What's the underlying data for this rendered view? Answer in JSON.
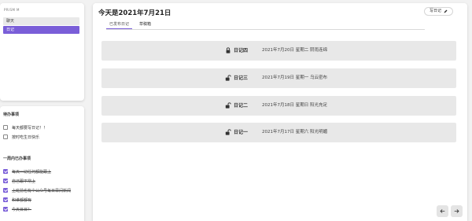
{
  "sidebar": {
    "brand": "PRISM M",
    "nav": [
      {
        "label": "聊天"
      },
      {
        "label": "日记"
      }
    ]
  },
  "todos": {
    "title": "待办事项",
    "items": [
      {
        "label": "每天都要写日记！！",
        "done": false
      },
      {
        "label": "按时吃生日快乐",
        "done": false
      }
    ]
  },
  "weekly_todos": {
    "title": "一周内已办事项",
    "items": [
      {
        "label": "每天一切任何都能跟上",
        "done": true
      },
      {
        "label": "自己跟平常上",
        "done": true
      },
      {
        "label": "上班前也有个公众号每日早间新闻",
        "done": true
      },
      {
        "label": "和谁都都有",
        "done": true
      },
      {
        "label": "今天日日？",
        "done": true
      }
    ]
  },
  "main": {
    "title": "今天是2021年7月21日",
    "write_button": "写日记",
    "tabs": [
      {
        "label": "已发布日记"
      },
      {
        "label": "草稿箱"
      }
    ],
    "diaries": [
      {
        "title": "日记四",
        "date": "2021年7月20日 星期二 阴雨连绵",
        "locked": true
      },
      {
        "title": "日记三",
        "date": "2021年7月19日 星期一 乌云密布",
        "locked": false
      },
      {
        "title": "日记二",
        "date": "2021年7月18日 星期日 阳光充足",
        "locked": false
      },
      {
        "title": "日记一",
        "date": "2021年7月17日 星期六 阳光明媚",
        "locked": false
      }
    ]
  },
  "colors": {
    "accent": "#7a5ed8",
    "card_bg": "#e8e8e8"
  }
}
